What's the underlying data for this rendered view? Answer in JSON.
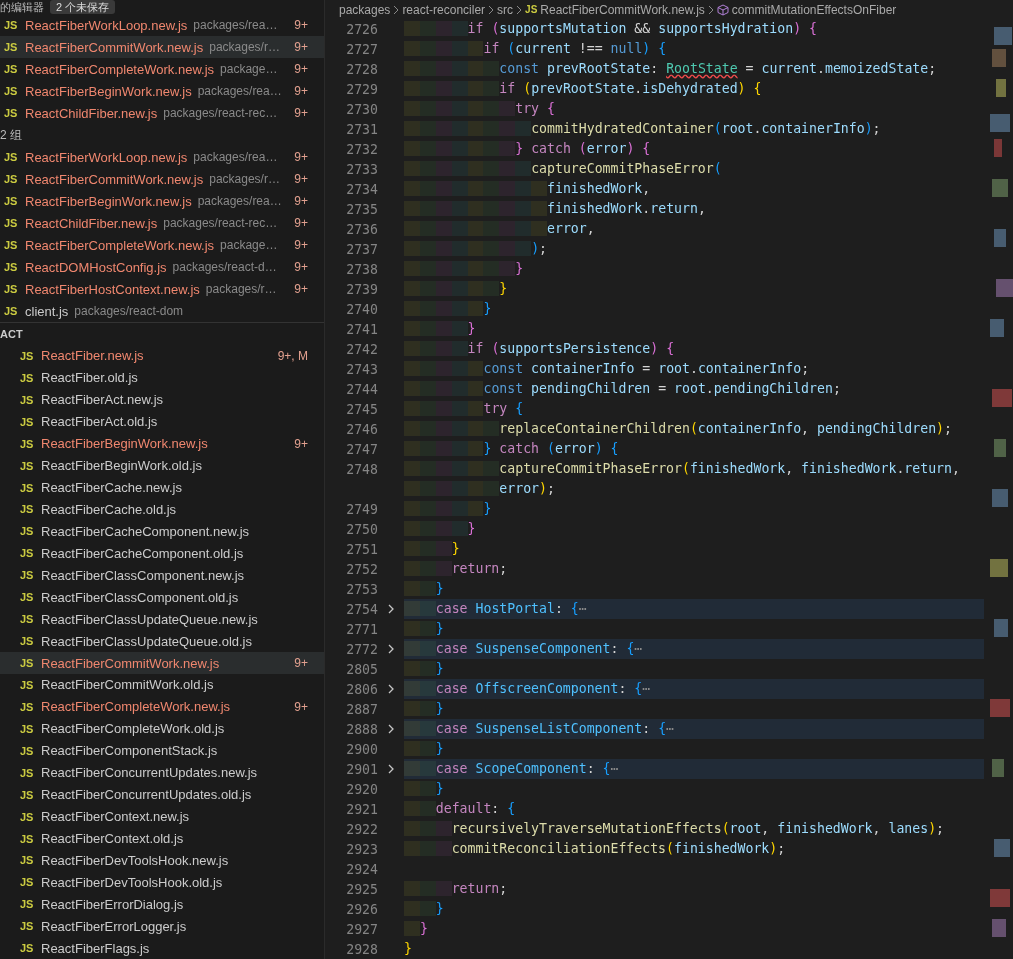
{
  "open_editors": {
    "title": "的编辑器",
    "badge": "2 个未保存",
    "groups": [
      {
        "files": [
          {
            "icon": "JS",
            "name": "ReactFiberWorkLoop.new.js",
            "path": "packages/rea…",
            "problems": "9+",
            "has_errors": true,
            "selected": false
          },
          {
            "icon": "JS",
            "name": "ReactFiberCommitWork.new.js",
            "path": "packages/r…",
            "problems": "9+",
            "has_errors": true,
            "selected": true
          },
          {
            "icon": "JS",
            "name": "ReactFiberCompleteWork.new.js",
            "path": "package…",
            "problems": "9+",
            "has_errors": true,
            "selected": false
          },
          {
            "icon": "JS",
            "name": "ReactFiberBeginWork.new.js",
            "path": "packages/rea…",
            "problems": "9+",
            "has_errors": true,
            "selected": false
          },
          {
            "icon": "JS",
            "name": "ReactChildFiber.new.js",
            "path": "packages/react-rec…",
            "problems": "9+",
            "has_errors": true,
            "selected": false
          }
        ]
      },
      {
        "label": "2 组",
        "files": [
          {
            "icon": "JS",
            "name": "ReactFiberWorkLoop.new.js",
            "path": "packages/rea…",
            "problems": "9+",
            "has_errors": true,
            "selected": false
          },
          {
            "icon": "JS",
            "name": "ReactFiberCommitWork.new.js",
            "path": "packages/r…",
            "problems": "9+",
            "has_errors": true,
            "selected": false
          },
          {
            "icon": "JS",
            "name": "ReactFiberBeginWork.new.js",
            "path": "packages/rea…",
            "problems": "9+",
            "has_errors": true,
            "selected": false
          },
          {
            "icon": "JS",
            "name": "ReactChildFiber.new.js",
            "path": "packages/react-rec…",
            "problems": "9+",
            "has_errors": true,
            "selected": false
          },
          {
            "icon": "JS",
            "name": "ReactFiberCompleteWork.new.js",
            "path": "package…",
            "problems": "9+",
            "has_errors": true,
            "selected": false
          },
          {
            "icon": "JS",
            "name": "ReactDOMHostConfig.js",
            "path": "packages/react-d…",
            "problems": "9+",
            "has_errors": true,
            "selected": false
          },
          {
            "icon": "JS",
            "name": "ReactFiberHostContext.new.js",
            "path": "packages/r…",
            "problems": "9+",
            "has_errors": true,
            "selected": false
          },
          {
            "icon": "JS",
            "name": "client.js",
            "path": "packages/react-dom",
            "has_errors": false,
            "selected": false
          }
        ]
      }
    ]
  },
  "explorer": {
    "title": "ACT",
    "files": [
      {
        "icon": "JS",
        "name": "ReactFiber.new.js",
        "problems": "9+, M",
        "has_errors": true,
        "selected": false
      },
      {
        "icon": "JS",
        "name": "ReactFiber.old.js",
        "has_errors": false,
        "selected": false
      },
      {
        "icon": "JS",
        "name": "ReactFiberAct.new.js",
        "has_errors": false,
        "selected": false
      },
      {
        "icon": "JS",
        "name": "ReactFiberAct.old.js",
        "has_errors": false,
        "selected": false
      },
      {
        "icon": "JS",
        "name": "ReactFiberBeginWork.new.js",
        "problems": "9+",
        "has_errors": true,
        "selected": false
      },
      {
        "icon": "JS",
        "name": "ReactFiberBeginWork.old.js",
        "has_errors": false,
        "selected": false
      },
      {
        "icon": "JS",
        "name": "ReactFiberCache.new.js",
        "has_errors": false,
        "selected": false
      },
      {
        "icon": "JS",
        "name": "ReactFiberCache.old.js",
        "has_errors": false,
        "selected": false
      },
      {
        "icon": "JS",
        "name": "ReactFiberCacheComponent.new.js",
        "has_errors": false,
        "selected": false
      },
      {
        "icon": "JS",
        "name": "ReactFiberCacheComponent.old.js",
        "has_errors": false,
        "selected": false
      },
      {
        "icon": "JS",
        "name": "ReactFiberClassComponent.new.js",
        "has_errors": false,
        "selected": false
      },
      {
        "icon": "JS",
        "name": "ReactFiberClassComponent.old.js",
        "has_errors": false,
        "selected": false
      },
      {
        "icon": "JS",
        "name": "ReactFiberClassUpdateQueue.new.js",
        "has_errors": false,
        "selected": false
      },
      {
        "icon": "JS",
        "name": "ReactFiberClassUpdateQueue.old.js",
        "has_errors": false,
        "selected": false
      },
      {
        "icon": "JS",
        "name": "ReactFiberCommitWork.new.js",
        "problems": "9+",
        "has_errors": true,
        "selected": true
      },
      {
        "icon": "JS",
        "name": "ReactFiberCommitWork.old.js",
        "has_errors": false,
        "selected": false
      },
      {
        "icon": "JS",
        "name": "ReactFiberCompleteWork.new.js",
        "problems": "9+",
        "has_errors": true,
        "selected": false
      },
      {
        "icon": "JS",
        "name": "ReactFiberCompleteWork.old.js",
        "has_errors": false,
        "selected": false
      },
      {
        "icon": "JS",
        "name": "ReactFiberComponentStack.js",
        "has_errors": false,
        "selected": false
      },
      {
        "icon": "JS",
        "name": "ReactFiberConcurrentUpdates.new.js",
        "has_errors": false,
        "selected": false
      },
      {
        "icon": "JS",
        "name": "ReactFiberConcurrentUpdates.old.js",
        "has_errors": false,
        "selected": false
      },
      {
        "icon": "JS",
        "name": "ReactFiberContext.new.js",
        "has_errors": false,
        "selected": false
      },
      {
        "icon": "JS",
        "name": "ReactFiberContext.old.js",
        "has_errors": false,
        "selected": false
      },
      {
        "icon": "JS",
        "name": "ReactFiberDevToolsHook.new.js",
        "has_errors": false,
        "selected": false
      },
      {
        "icon": "JS",
        "name": "ReactFiberDevToolsHook.old.js",
        "has_errors": false,
        "selected": false
      },
      {
        "icon": "JS",
        "name": "ReactFiberErrorDialog.js",
        "has_errors": false,
        "selected": false
      },
      {
        "icon": "JS",
        "name": "ReactFiberErrorLogger.js",
        "has_errors": false,
        "selected": false
      },
      {
        "icon": "JS",
        "name": "ReactFiberFlags.js",
        "has_errors": false,
        "selected": false
      }
    ]
  },
  "breadcrumbs": [
    {
      "text": "packages",
      "kind": "folder"
    },
    {
      "text": "react-reconciler",
      "kind": "folder"
    },
    {
      "text": "src",
      "kind": "folder"
    },
    {
      "text": "ReactFiberCommitWork.new.js",
      "kind": "file",
      "icon": "JS"
    },
    {
      "text": "commitMutationEffectsOnFiber",
      "kind": "symbol"
    }
  ],
  "lines": [
    {
      "number": "2726",
      "folded": false,
      "text": "        if (supportsMutation && supportsHydration) {"
    },
    {
      "number": "2727",
      "folded": false,
      "text": "          if (current !== null) {"
    },
    {
      "number": "2728",
      "folded": false,
      "segments": [
        {
          "text": "            const prevRootState: ",
          "squiggle": false
        },
        {
          "text": "RootState",
          "squiggle": true
        },
        {
          "text": " = current.memoizedState;",
          "squiggle": false
        }
      ]
    },
    {
      "number": "2729",
      "folded": false,
      "text": "            if (prevRootState.isDehydrated) {"
    },
    {
      "number": "2730",
      "folded": false,
      "text": "              try {"
    },
    {
      "number": "2731",
      "folded": false,
      "text": "                commitHydratedContainer(root.containerInfo);"
    },
    {
      "number": "2732",
      "folded": false,
      "text": "              } catch (error) {"
    },
    {
      "number": "2733",
      "folded": false,
      "text": "                captureCommitPhaseError("
    },
    {
      "number": "2734",
      "folded": false,
      "text": "                  finishedWork,"
    },
    {
      "number": "2735",
      "folded": false,
      "text": "                  finishedWork.return,"
    },
    {
      "number": "2736",
      "folded": false,
      "text": "                  error,"
    },
    {
      "number": "2737",
      "folded": false,
      "text": "                );"
    },
    {
      "number": "2738",
      "folded": false,
      "text": "              }"
    },
    {
      "number": "2739",
      "folded": false,
      "text": "            }"
    },
    {
      "number": "2740",
      "folded": false,
      "text": "          }"
    },
    {
      "number": "2741",
      "folded": false,
      "text": "        }"
    },
    {
      "number": "2742",
      "folded": false,
      "text": "        if (supportsPersistence) {"
    },
    {
      "number": "2743",
      "folded": false,
      "text": "          const containerInfo = root.containerInfo;"
    },
    {
      "number": "2744",
      "folded": false,
      "text": "          const pendingChildren = root.pendingChildren;"
    },
    {
      "number": "2745",
      "folded": false,
      "text": "          try {"
    },
    {
      "number": "2746",
      "folded": false,
      "text": "            replaceContainerChildren(containerInfo, pendingChildren);"
    },
    {
      "number": "2747",
      "folded": false,
      "text": "          } catch (error) {"
    },
    {
      "number": "2748",
      "folded": false,
      "text": "            captureCommitPhaseError(finishedWork, finishedWork.return,"
    },
    {
      "folded": false,
      "text": "            error);"
    },
    {
      "number": "2749",
      "folded": false,
      "text": "          }"
    },
    {
      "number": "2750",
      "folded": false,
      "text": "        }"
    },
    {
      "number": "2751",
      "folded": false,
      "text": "      }"
    },
    {
      "number": "2752",
      "folded": false,
      "text": "      return;"
    },
    {
      "number": "2753",
      "folded": false,
      "text": "    }"
    },
    {
      "number": "2754",
      "folded": true,
      "text": "    case HostPortal: {⋯"
    },
    {
      "number": "2771",
      "folded": false,
      "text": "    }"
    },
    {
      "number": "2772",
      "folded": true,
      "text": "    case SuspenseComponent: {⋯"
    },
    {
      "number": "2805",
      "folded": false,
      "text": "    }"
    },
    {
      "number": "2806",
      "folded": true,
      "text": "    case OffscreenComponent: {⋯"
    },
    {
      "number": "2887",
      "folded": false,
      "text": "    }"
    },
    {
      "number": "2888",
      "folded": true,
      "text": "    case SuspenseListComponent: {⋯"
    },
    {
      "number": "2900",
      "folded": false,
      "text": "    }"
    },
    {
      "number": "2901",
      "folded": true,
      "text": "    case ScopeComponent: {⋯"
    },
    {
      "number": "2920",
      "folded": false,
      "text": "    }"
    },
    {
      "number": "2921",
      "folded": false,
      "text": "    default: {"
    },
    {
      "number": "2922",
      "folded": false,
      "text": "      recursivelyTraverseMutationEffects(root, finishedWork, lanes);"
    },
    {
      "number": "2923",
      "folded": false,
      "text": "      commitReconciliationEffects(finishedWork);"
    },
    {
      "number": "2924",
      "folded": false
    },
    {
      "number": "2925",
      "folded": false,
      "text": "      return;"
    },
    {
      "number": "2926",
      "folded": false,
      "text": "    }"
    },
    {
      "number": "2927",
      "folded": false,
      "text": "  }"
    },
    {
      "number": "2928",
      "folded": false,
      "text": "}"
    }
  ]
}
